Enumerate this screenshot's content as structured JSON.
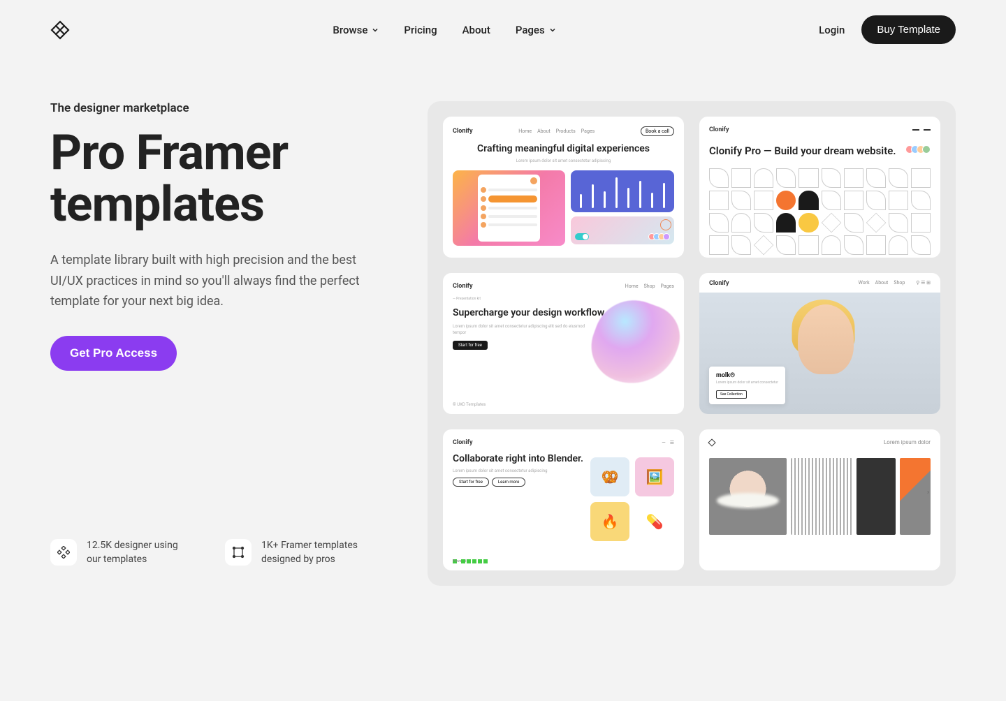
{
  "nav": {
    "items": [
      {
        "label": "Browse",
        "hasDropdown": true
      },
      {
        "label": "Pricing",
        "hasDropdown": false
      },
      {
        "label": "About",
        "hasDropdown": false
      },
      {
        "label": "Pages",
        "hasDropdown": true
      }
    ],
    "login": "Login",
    "buy": "Buy Template"
  },
  "hero": {
    "eyebrow": "The designer marketplace",
    "title": "Pro Framer templates",
    "desc": "A template library built with high precision and the best UI/UX practices in mind so you'll always find the perfect template for your next big idea.",
    "cta": "Get Pro Access"
  },
  "stats": [
    {
      "text": "12.5K designer using our templates"
    },
    {
      "text": "1K+ Framer templates designed by pros"
    }
  ],
  "cards": {
    "c1": {
      "brand": "Clonify",
      "title": "Crafting meaningful digital experiences",
      "pill": "Book a call"
    },
    "c2": {
      "brand": "Clonify",
      "title": "Clonify Pro — Build your dream website."
    },
    "c3": {
      "brand": "Clonify",
      "title": "Supercharge your design workflow",
      "btn": "Start for free",
      "foot": "© UXD Templates"
    },
    "c4": {
      "brand": "Clonify",
      "overlay_title": "molk®",
      "overlay_btn": "See Collection"
    },
    "c5": {
      "brand": "Clonify",
      "title": "Collaborate right into Blender.",
      "btn1": "Start for free",
      "btn2": "Learn more"
    },
    "c6": {
      "text": "Lorem ipsum dolor"
    }
  }
}
